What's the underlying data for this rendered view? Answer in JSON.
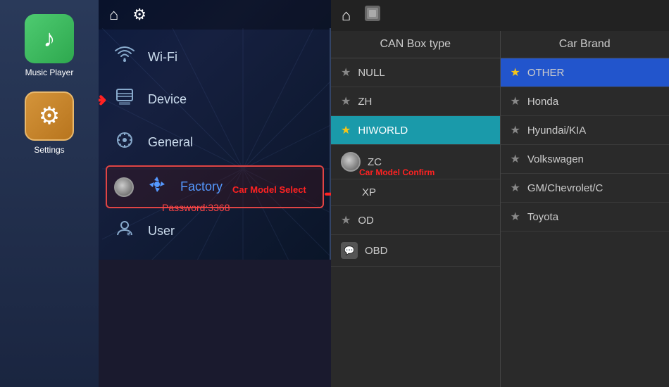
{
  "sidebar": {
    "apps": [
      {
        "id": "music-player",
        "label": "Music Player",
        "icon": "♪",
        "iconClass": "music-icon-box"
      },
      {
        "id": "settings",
        "label": "Settings",
        "icon": "⚙",
        "iconClass": "settings-icon-box"
      }
    ]
  },
  "middlePanel": {
    "headerIcons": [
      "home",
      "settings"
    ],
    "menu": [
      {
        "id": "wifi",
        "label": "Wi-Fi",
        "icon": "📶"
      },
      {
        "id": "device",
        "label": "Device",
        "icon": "📱"
      },
      {
        "id": "general",
        "label": "General",
        "icon": "⚙"
      },
      {
        "id": "factory",
        "label": "Factory",
        "icon": "🔧",
        "active": true
      },
      {
        "id": "user",
        "label": "User",
        "icon": "👤"
      }
    ],
    "passwordLabel": "Password:3368",
    "annotations": {
      "carModelSelect": "Car Model Select",
      "carModelConfirm": "Car Model Confirm"
    }
  },
  "rightPanel": {
    "canBoxColumn": {
      "header": "CAN Box type",
      "items": [
        {
          "id": "null",
          "label": "NULL",
          "starred": false
        },
        {
          "id": "zh",
          "label": "ZH",
          "starred": false
        },
        {
          "id": "hiworld",
          "label": "HIWORLD",
          "starred": true,
          "highlighted": true
        },
        {
          "id": "zc",
          "label": "ZC",
          "toggle": true
        },
        {
          "id": "xp",
          "label": "XP",
          "starred": false
        },
        {
          "id": "od",
          "label": "OD",
          "starred": false
        },
        {
          "id": "obd",
          "label": "OBD",
          "bubble": true
        }
      ]
    },
    "carBrandColumn": {
      "header": "Car Brand",
      "items": [
        {
          "id": "other",
          "label": "OTHER",
          "starred": true,
          "highlighted": true
        },
        {
          "id": "honda",
          "label": "Honda",
          "starred": false
        },
        {
          "id": "hyundai",
          "label": "Hyundai/KIA",
          "starred": false
        },
        {
          "id": "volkswagen",
          "label": "Volkswagen",
          "starred": false
        },
        {
          "id": "gm",
          "label": "GM/Chevrolet/C",
          "starred": false
        },
        {
          "id": "toyota",
          "label": "Toyota",
          "starred": false
        }
      ]
    }
  }
}
